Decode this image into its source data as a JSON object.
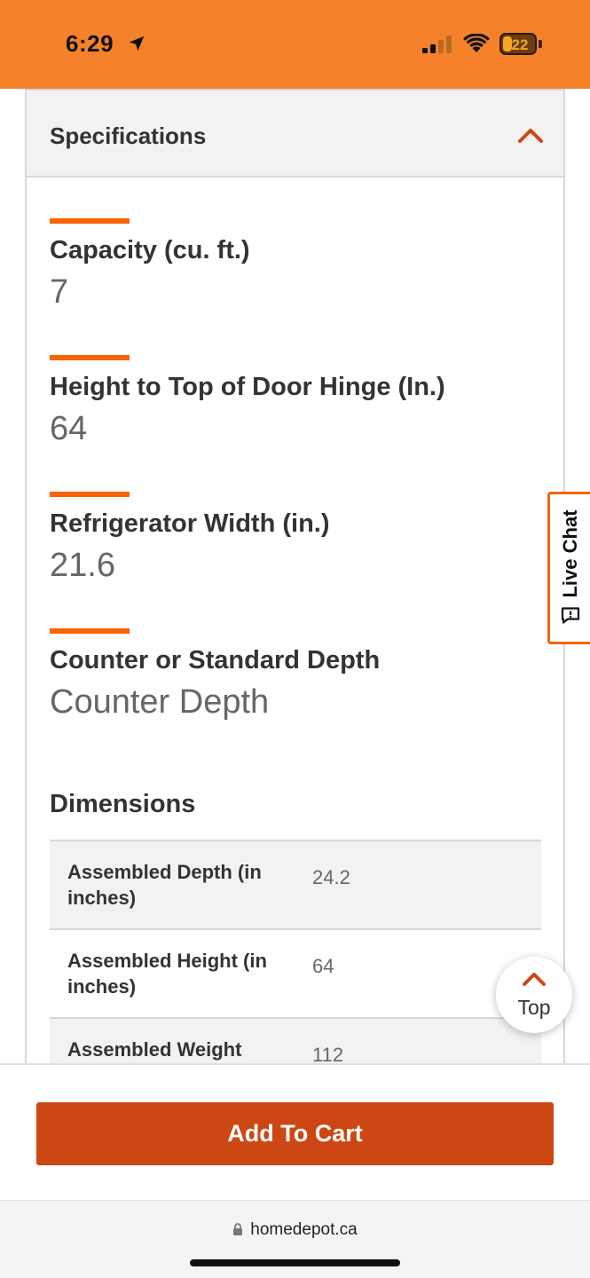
{
  "status_bar": {
    "time": "6:29",
    "battery": "22",
    "background_color": "#f5822a"
  },
  "specifications": {
    "title": "Specifications",
    "items": [
      {
        "label": "Capacity (cu. ft.)",
        "value": "7"
      },
      {
        "label": "Height to Top of Door Hinge (In.)",
        "value": "64"
      },
      {
        "label": "Refrigerator Width (in.)",
        "value": "21.6"
      },
      {
        "label": "Counter or Standard Depth",
        "value": "Counter Depth"
      }
    ]
  },
  "dimensions": {
    "title": "Dimensions",
    "rows": [
      {
        "name": "Assembled Depth (in inches)",
        "value": "24.2"
      },
      {
        "name": "Assembled Height (in inches)",
        "value": "64"
      },
      {
        "name": "Assembled Weight",
        "value": "112"
      }
    ]
  },
  "live_chat": {
    "label": "Live Chat"
  },
  "top_button": {
    "label": "Top"
  },
  "cart": {
    "button_label": "Add To Cart",
    "button_color": "#cc4714"
  },
  "browser": {
    "url": "homedepot.ca"
  },
  "icons": {
    "location": "location-arrow-icon",
    "signal": "cell-signal-icon",
    "wifi": "wifi-icon",
    "battery": "battery-icon",
    "collapse": "chevron-up-icon",
    "chat": "chat-bubble-icon",
    "lock": "lock-icon"
  },
  "accent_color": "#f96302"
}
